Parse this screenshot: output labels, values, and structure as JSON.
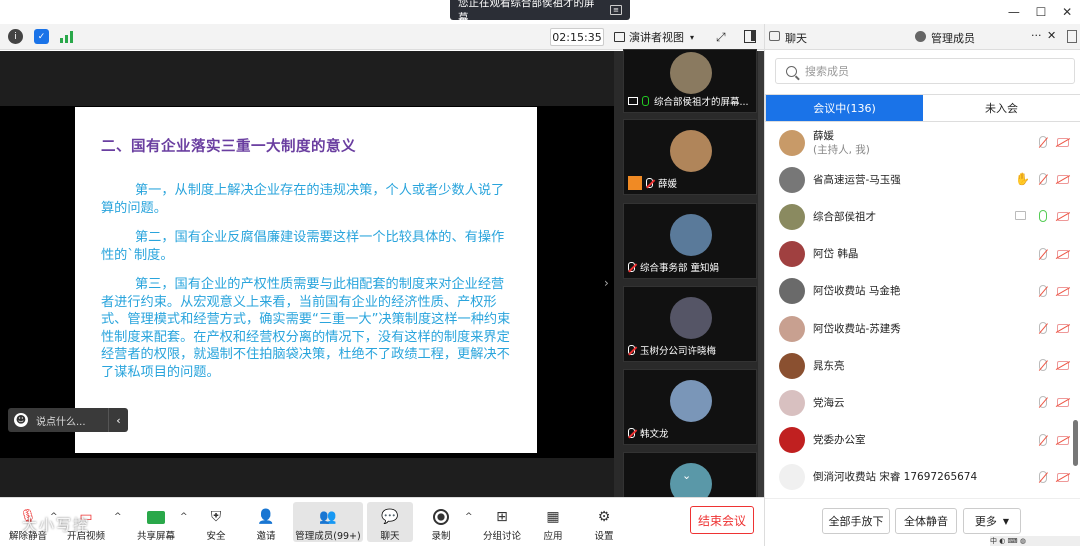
{
  "banner": {
    "text": "您正在观看综合部侯祖才的屏幕"
  },
  "window_controls": {
    "minimize": "—",
    "maximize": "☐",
    "close": "✕"
  },
  "topbar": {
    "clock": "02:15:35",
    "view_label": "演讲者视图",
    "info_icon": "i"
  },
  "slide": {
    "title": "二、国有企业落实三重一大制度的意义",
    "paragraphs": [
      "第一，从制度上解决企业存在的违规决策，个人或者少数人说了算的问题。",
      "第二，国有企业反腐倡廉建设需要这样一个比较具体的、有操作性的`制度。",
      "第三，国有企业的产权性质需要与此相配套的制度来对企业经营者进行约束。从宏观意义上来看，当前国有企业的经济性质、产权形式、管理模式和经营方式，确实需要“三重一大”决策制度这样一种约束性制度来配套。在产权和经营权分离的情况下，没有这样的制度来界定经营者的权限，就遏制不住拍脑袋决策，杜绝不了政绩工程，更解决不了谋私项目的问题。"
    ]
  },
  "say_box": {
    "placeholder": "说点什么..."
  },
  "video_tiles": [
    {
      "name": "综合部侯祖才的屏幕...",
      "color": "#8a7a60"
    },
    {
      "name": "薛媛",
      "color": "#b0855a"
    },
    {
      "name": "综合事务部 童知娟",
      "color": "#5a7a9a"
    },
    {
      "name": "玉树分公司许晓梅",
      "color": "#556"
    },
    {
      "name": "韩文龙",
      "color": "#7a96b8"
    },
    {
      "name": "",
      "color": "#5a98a8"
    }
  ],
  "bottom_bar": {
    "buttons": [
      {
        "label": "解除静音",
        "icon": "mic-muted-icon"
      },
      {
        "label": "开启视频",
        "icon": "camera-off-icon"
      },
      {
        "label": "共享屏幕",
        "icon": "share-screen-icon"
      },
      {
        "label": "安全",
        "icon": "shield-icon"
      },
      {
        "label": "邀请",
        "icon": "invite-icon"
      },
      {
        "label": "管理成员(99+)",
        "icon": "members-icon"
      },
      {
        "label": "聊天",
        "icon": "chat-icon"
      },
      {
        "label": "录制",
        "icon": "record-icon"
      },
      {
        "label": "分组讨论",
        "icon": "breakout-icon"
      },
      {
        "label": "应用",
        "icon": "apps-icon"
      },
      {
        "label": "设置",
        "icon": "gear-icon"
      }
    ],
    "end_meeting": "结束会议",
    "watermark": "大小写控"
  },
  "right_panel": {
    "tab_chat": "聊天",
    "tab_members": "管理成员",
    "more": "···",
    "close": "✕",
    "search_placeholder": "搜索成员",
    "tab_in_meeting": "会议中(136)",
    "tab_not_joined": "未入会",
    "members": [
      {
        "name": "薛媛",
        "sub": "(主持人, 我)",
        "color": "#c89a68",
        "hand": false,
        "mic": "muted"
      },
      {
        "name": "省高速运营-马玉强",
        "sub": "",
        "color": "#777",
        "hand": true,
        "mic": "muted"
      },
      {
        "name": "综合部侯祖才",
        "sub": "",
        "color": "#8a8a60",
        "hand": false,
        "mic": "on"
      },
      {
        "name": "阿岱 韩晶",
        "sub": "",
        "color": "#a04040",
        "hand": false,
        "mic": "muted"
      },
      {
        "name": "阿岱收费站  马金艳",
        "sub": "",
        "color": "#6a6a6a",
        "hand": false,
        "mic": "muted"
      },
      {
        "name": "阿岱收费站-苏建秀",
        "sub": "",
        "color": "#c8a090",
        "hand": false,
        "mic": "muted"
      },
      {
        "name": "晁东亮",
        "sub": "",
        "color": "#8a5030",
        "hand": false,
        "mic": "muted"
      },
      {
        "name": "党海云",
        "sub": "",
        "color": "#d8c0c0",
        "hand": false,
        "mic": "muted"
      },
      {
        "name": "党委办公室",
        "sub": "",
        "color": "#c02020",
        "hand": false,
        "mic": "muted"
      },
      {
        "name": "倒淌河收费站  宋睿  17697265674",
        "sub": "",
        "color": "#f0f0f0",
        "hand": false,
        "mic": "muted"
      }
    ],
    "btn_all_hands_down": "全部手放下",
    "btn_mute_all": "全体静音",
    "btn_more": "更多"
  },
  "taskbar": {
    "text": "中 ◐ ⌨ ◍"
  }
}
